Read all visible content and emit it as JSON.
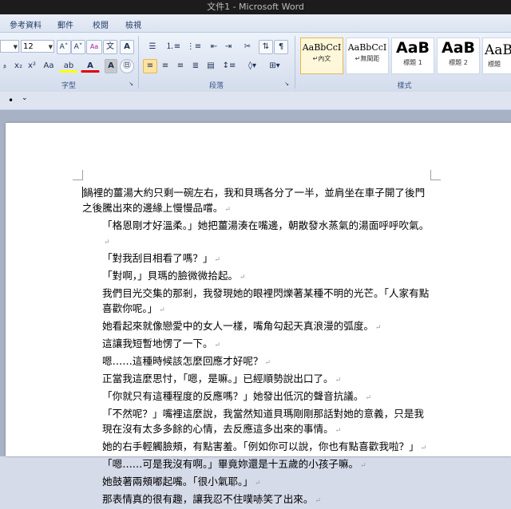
{
  "title_bar": {
    "title": "文件1 - Microsoft Word"
  },
  "tabs": [
    "參考資料",
    "郵件",
    "校閱",
    "檢視"
  ],
  "font": {
    "size": "12",
    "grow_label": "A˄",
    "shrink_label": "A˅",
    "clear_label": "Aa",
    "subscript": "x₂",
    "superscript": "x²",
    "change_case": "Aa",
    "highlight_label": "ab",
    "color_label": "A",
    "group_label": "字型"
  },
  "paragraph": {
    "group_label": "段落"
  },
  "styles": {
    "group_label": "樣式",
    "items": [
      {
        "sample": "AaBbCcI",
        "name": "↵內文"
      },
      {
        "sample": "AaBbCcI",
        "name": "↵無間距"
      },
      {
        "sample": "AaB",
        "name": "標題 1"
      },
      {
        "sample": "AaB",
        "name": "標題 2"
      },
      {
        "sample": "AaBl",
        "name": "標題"
      }
    ]
  },
  "quick_access": {
    "bullet": "•",
    "more": "⌄"
  },
  "document": {
    "paragraph_mark": "↵",
    "paragraphs": [
      {
        "text": "鍋裡的薑湯大約只剩一碗左右，我和貝瑪各分了一半，並肩坐在車子開了後門之後騰出來的邊緣上慢慢品嚐。",
        "indent": false
      },
      {
        "text": "「格恩剛才好溫柔。」她把薑湯湊在嘴邊，朝散發水蒸氣的湯面呼呼吹氣。",
        "indent": true
      },
      {
        "text": "「對我刮目相看了嗎？」",
        "indent": true
      },
      {
        "text": "「對啊，」貝瑪的臉微微拾起。",
        "indent": true
      },
      {
        "text": "我們目光交集的那剎，我發現她的眼裡閃爍著某種不明的光芒。「人家有點喜歡你呢。」",
        "indent": true
      },
      {
        "text": "她看起來就像戀愛中的女人一樣，嘴角勾起天真浪漫的弧度。",
        "indent": true
      },
      {
        "text": "這讓我短暫地愣了一下。",
        "indent": true
      },
      {
        "text": "嗯……這種時候該怎麼回應才好呢？",
        "indent": true
      },
      {
        "text": "正當我這麼思忖，「嗯，是嘛。」已經順勢說出口了。",
        "indent": true
      },
      {
        "text": "「你就只有這種程度的反應嗎？」她發出低沉的聲音抗議。",
        "indent": true
      },
      {
        "text": "「不然呢？」嘴裡這麼說，我當然知道貝瑪剛剛那話對她的意義，只是我現在沒有太多多餘的心情，去反應這多出來的事情。",
        "indent": true
      },
      {
        "text": "她的右手輕觸臉頰，有點害羞。「例如你可以說，你也有點喜歡我啦？」",
        "indent": true
      },
      {
        "text": "「嗯……可是我沒有啊。」畢竟妳還是十五歲的小孩子嘛。",
        "indent": true
      },
      {
        "text": "她鼓著兩頰嘟起嘴。「很小氣耶。」",
        "indent": true
      },
      {
        "text": "那表情真的很有趣，讓我忍不住噗哧笑了出來。",
        "indent": true
      }
    ]
  }
}
